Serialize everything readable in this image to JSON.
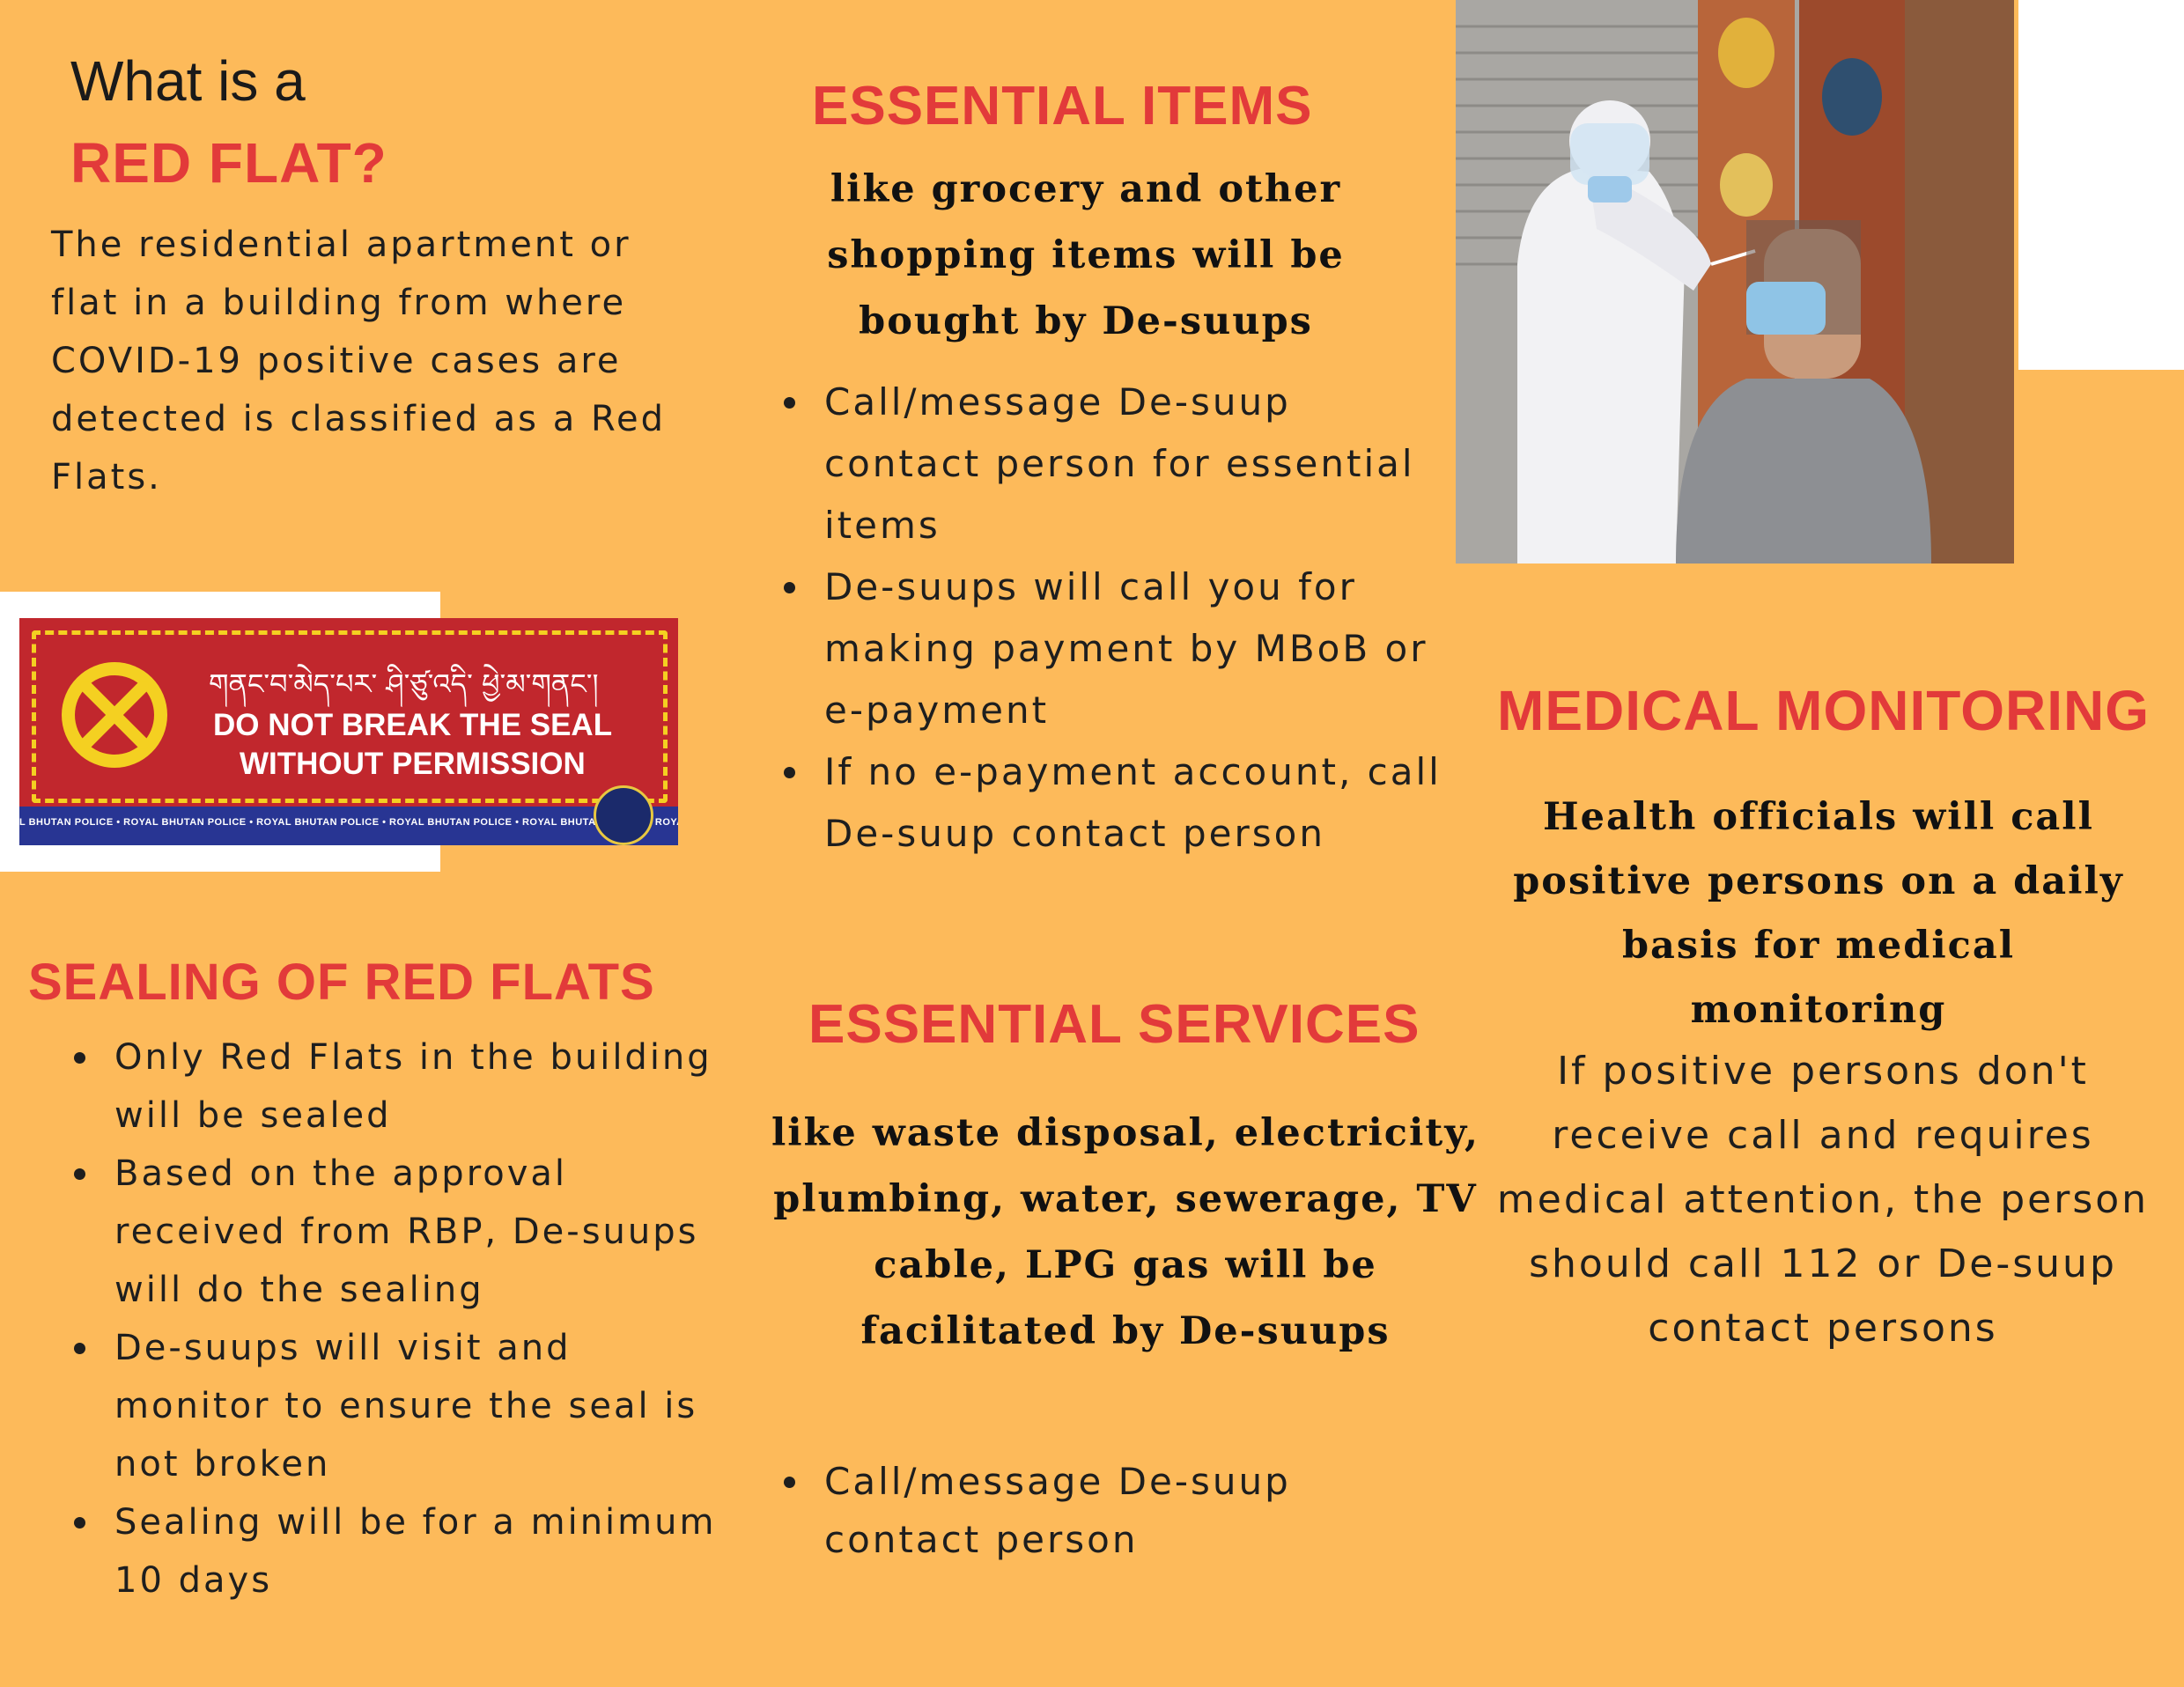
{
  "red_flat": {
    "intro": "What is a",
    "title": "RED FLAT?",
    "description": "The residential apartment or flat in a building from where  COVID-19 positive cases are detected is classified as a Red Flats."
  },
  "seal_sign": {
    "tibetan_text": "གནང་བ་མེད་པར་ ཤི་ཙུ་འདི་ ཕྱེ་མ་གནང་།",
    "line1": "DO NOT BREAK THE SEAL",
    "line2": "WITHOUT PERMISSION",
    "strip_text": "L BHUTAN POLICE • ROYAL BHUTAN POLICE • ROYAL BHUTAN POLICE • ROYAL BHUTAN POLICE • ROYAL BHUTAN POLICE • ROYAL BHUTAN POLICE • ROYAL BHUTAN POLICE • ROYAL BHUTAN POLICE • ROYAL BHUTAN",
    "icon": "x-circle-icon",
    "colors": {
      "background": "#c1272d",
      "accent": "#f4d021",
      "strip": "#283593"
    }
  },
  "sealing": {
    "title": "SEALING OF RED FLATS",
    "items": [
      "Only Red Flats in the building will be sealed",
      "Based on the approval received from RBP, De-suups will do the sealing",
      "De-suups will visit and monitor to ensure the seal is not broken",
      "Sealing will be for a minimum 10 days"
    ]
  },
  "essential_items": {
    "title": "ESSENTIAL ITEMS",
    "subtitle": "like grocery and other shopping items will be bought by De-suups",
    "items": [
      "Call/message De-suup contact person for essential items",
      "De-suups will call you for making payment by MBoB or e-payment",
      "If no e-payment account, call De-suup contact person"
    ]
  },
  "essential_services": {
    "title": "ESSENTIAL SERVICES",
    "subtitle": "like waste disposal, electricity, plumbing, water, sewerage, TV cable, LPG gas will be facilitated by De-suups",
    "items": [
      "Call/message De-suup contact person"
    ]
  },
  "medical_monitoring": {
    "title": "MEDICAL MONITORING",
    "subtitle": "Health officials will call  positive persons on a daily basis for medical monitoring",
    "note": "If positive persons don't receive  call and requires medical attention, the person should call 112  or De-suup contact persons"
  },
  "theme": {
    "background": "#fdba5a",
    "heading_red": "#e23a3a"
  }
}
